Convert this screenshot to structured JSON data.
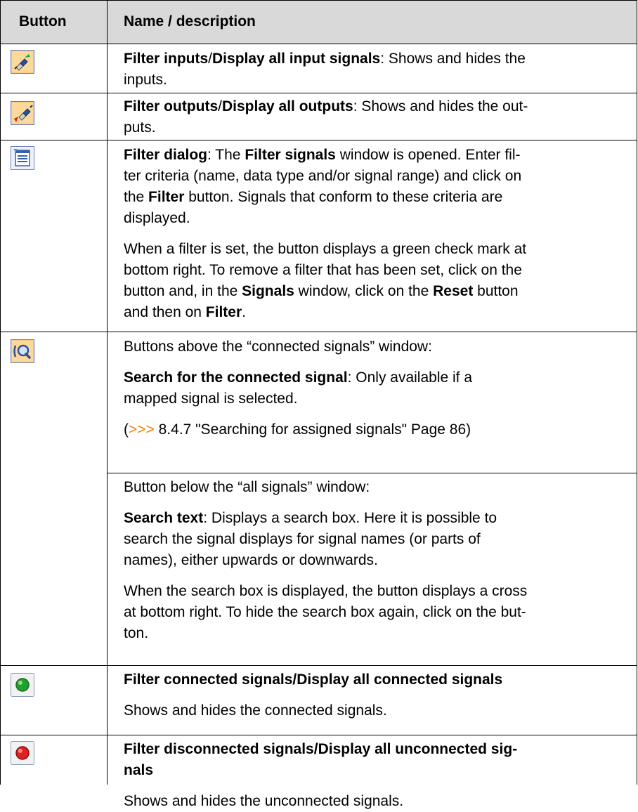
{
  "header": {
    "col1": "Button",
    "col2": "Name / description"
  },
  "rows": [
    {
      "icon": "filter-inputs-icon",
      "p1": {
        "b1": "Filter inputs",
        "t1": "/",
        "b2": "Display all input signals",
        "t2": ": Shows and hides the",
        "t3": "inputs."
      }
    },
    {
      "icon": "filter-outputs-icon",
      "p1": {
        "b1": "Filter outputs",
        "t1": "/",
        "b2": "Display all outputs",
        "t2": ": Shows and hides the out-",
        "t3": "puts."
      }
    },
    {
      "icon": "filter-dialog-icon",
      "p1": {
        "b1": "Filter dialog",
        "t1": ": The ",
        "b2": "Filter signals",
        "t2": " window is opened. Enter fil-",
        "l2": "ter criteria (name, data type and/or signal range) and click on",
        "l3a": "the ",
        "l3b": "Filter",
        "l3c": " button. Signals that conform to these criteria are",
        "l4": "displayed."
      },
      "p2": {
        "l1": "When a filter is set, the button displays a green check mark at",
        "l2": "bottom right. To remove a filter that has been set, click on the",
        "l3a": "button and, in the ",
        "l3b": "Signals",
        "l3c": " window, click on the ",
        "l3d": "Reset",
        "l3e": " button",
        "l4a": "and then on ",
        "l4b": "Filter",
        "l4c": "."
      }
    },
    {
      "icon": "search-icon",
      "p1": {
        "l1": "Buttons above the “connected signals” window:"
      },
      "p2": {
        "b1": "Search for the connected signal",
        "t1": ": Only available if a",
        "l2": "mapped signal is selected."
      },
      "p3": {
        "open": "(",
        "arrows": ">>>",
        "text": " 8.4.7 \"Searching for assigned signals\" Page 86)"
      }
    },
    {
      "p1": {
        "l1": "Button below the “all signals” window:"
      },
      "p2": {
        "b1": "Search text",
        "t1": ": Displays a search box. Here it is possible to",
        "l2": "search the signal displays for signal names (or parts of",
        "l3": "names), either upwards or downwards."
      },
      "p3": {
        "l1": "When the search box is displayed, the button displays a cross",
        "l2": "at bottom right. To hide the search box again, click on the but-",
        "l3": "ton."
      }
    },
    {
      "icon": "green-led-icon",
      "p1": {
        "b1": "Filter connected signals",
        "t1": "/",
        "b2": "Display all connected signals"
      },
      "p2": {
        "l1": "Shows and hides the connected signals."
      }
    },
    {
      "icon": "red-led-icon",
      "p1": {
        "b1": "Filter disconnected signals",
        "t1": "/",
        "b2": "Display all unconnected sig-",
        "l2": "nals"
      },
      "p2": {
        "l1": "Shows and hides the unconnected signals."
      }
    }
  ],
  "colors": {
    "header_bg": "#d9d9d9",
    "link_color": "#f07f00",
    "border": "#000000"
  }
}
